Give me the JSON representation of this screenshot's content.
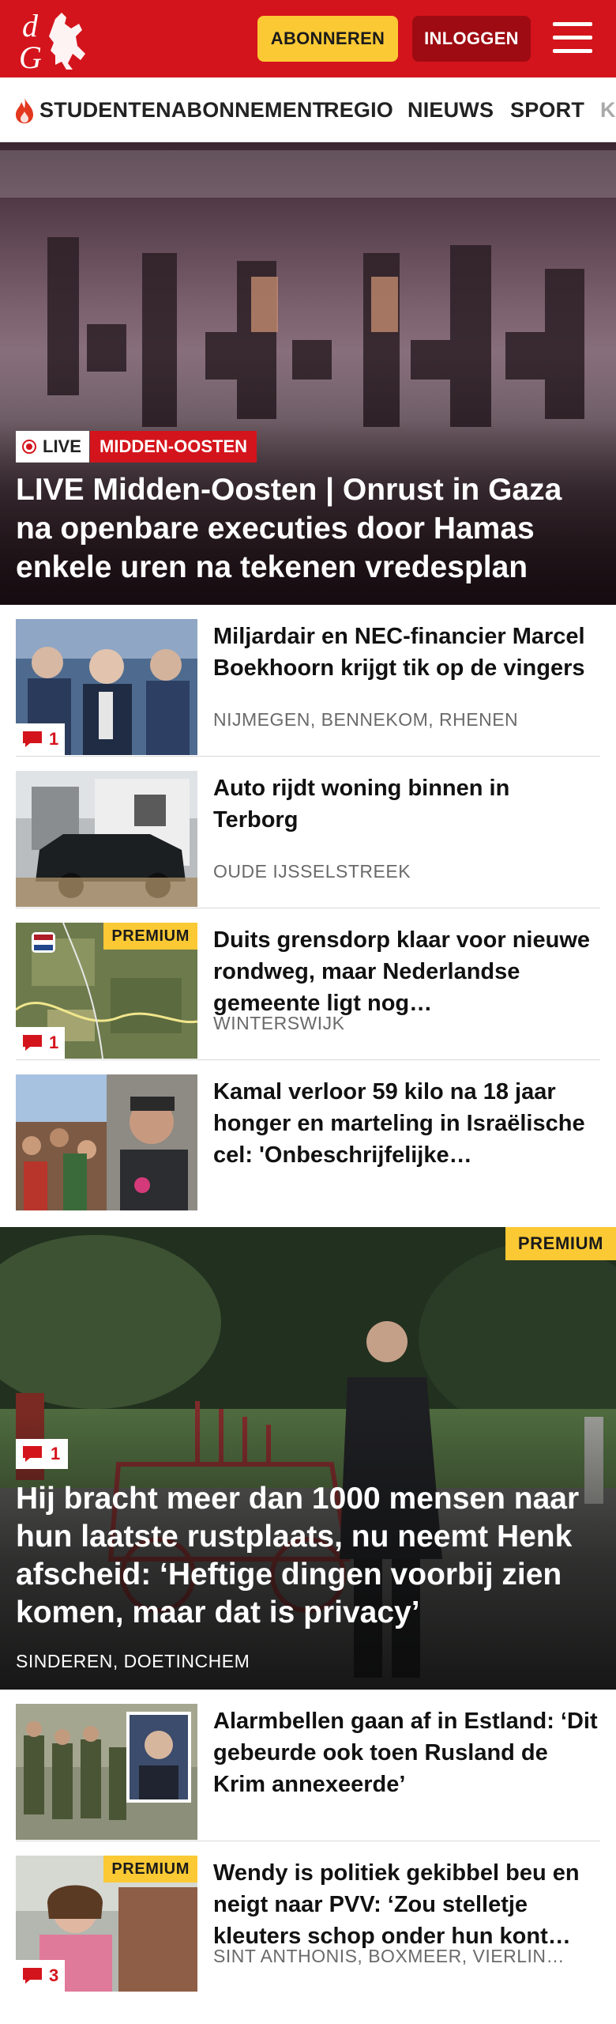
{
  "header": {
    "subscribe_label": "ABONNEREN",
    "login_label": "INLOGGEN",
    "brand_color": "#d4141c",
    "logo_letters": "dG"
  },
  "nav": {
    "items": [
      {
        "label": "STUDENTENABONNEMENT",
        "icon": "flame-icon"
      },
      {
        "label": "REGIO"
      },
      {
        "label": "NIEUWS"
      },
      {
        "label": "SPORT"
      },
      {
        "label": "K"
      }
    ]
  },
  "hero": {
    "live_label": "LIVE",
    "section_label": "MIDDEN-OOSTEN",
    "title": "LIVE Midden-Oosten | Onrust in Gaza na openbare executies door Hamas enkele uren na tekenen vredesplan"
  },
  "articles": [
    {
      "title": "Miljardair en NEC-financier Marcel Boekhoorn krijgt tik op de vingers",
      "location": "NIJMEGEN, BENNEKOM, RHENEN",
      "comments": "1",
      "premium": ""
    },
    {
      "title": "Auto rijdt woning binnen in Terborg",
      "location": "OUDE IJSSELSTREEK",
      "comments": "",
      "premium": ""
    },
    {
      "title": "Duits grensdorp klaar voor nieuwe rondweg, maar Nederlandse gemeente ligt nog…",
      "location": "WINTERSWIJK",
      "comments": "1",
      "premium": "PREMIUM"
    },
    {
      "title": "Kamal verloor 59 kilo na 18 jaar honger en marteling in Israëli­sche cel: 'Onbeschrijfelijke…",
      "location": "",
      "comments": "",
      "premium": ""
    }
  ],
  "feature": {
    "premium": "PREMIUM",
    "comments": "1",
    "title": "Hij bracht meer dan 1000 mensen naar hun laatste rustplaats, nu neemt Henk afscheid: ‘Heftige dingen voorbij zien komen, maar dat is privacy’",
    "location": "SINDEREN, DOETINCHEM"
  },
  "articles2": [
    {
      "title": "Alarmbellen gaan af in Estland: ‘Dit gebeurde ook toen Rusland de Krim annexeerde’",
      "location": "",
      "comments": "",
      "premium": ""
    },
    {
      "title": "Wendy is politiek gekibbel beu en neigt naar PVV: ‘Zou stelletje kleuters schop onder hun kont…",
      "location": "SINT ANTHONIS, BOXMEER, VIERLIN…",
      "comments": "3",
      "premium": "PREMIUM"
    }
  ],
  "colors": {
    "accent_red": "#d4141c",
    "premium_yellow": "#fbc934",
    "login_dark_red": "#9e0b12"
  }
}
